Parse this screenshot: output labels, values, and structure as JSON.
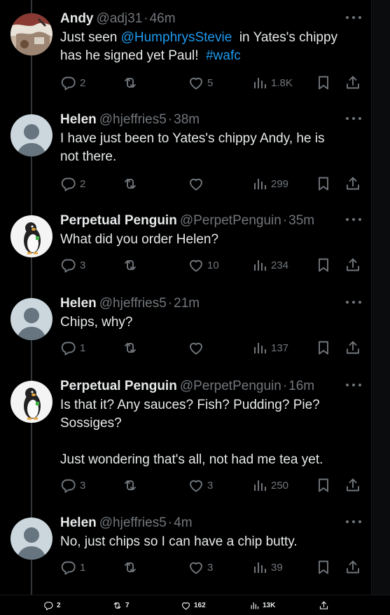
{
  "tweets": [
    {
      "name": "Andy",
      "handle": "@adj31",
      "time": "46m",
      "avatar": "photo-avatar",
      "lines": [
        {
          "parts": [
            {
              "t": "Just seen ",
              "link": false
            },
            {
              "t": "@HumphrysStevie",
              "link": true
            },
            {
              "t": "  in Yates's chippy",
              "link": false
            }
          ]
        },
        {
          "parts": [
            {
              "t": "has he signed yet Paul!  ",
              "link": false
            },
            {
              "t": "#wafc",
              "link": true
            }
          ]
        }
      ],
      "replies": "2",
      "retweets": "",
      "likes": "5",
      "views": "1.8K"
    },
    {
      "name": "Helen",
      "handle": "@hjeffries5",
      "time": "38m",
      "avatar": "default-avatar",
      "lines": [
        {
          "parts": [
            {
              "t": "I have just been to Yates's chippy Andy, he is",
              "link": false
            }
          ]
        },
        {
          "parts": [
            {
              "t": "not there.",
              "link": false
            }
          ]
        }
      ],
      "replies": "2",
      "retweets": "",
      "likes": "",
      "views": "299"
    },
    {
      "name": "Perpetual Penguin",
      "handle": "@PerpetPenguin",
      "time": "35m",
      "avatar": "penguin-avatar",
      "lines": [
        {
          "parts": [
            {
              "t": "What did you order Helen?",
              "link": false
            }
          ]
        }
      ],
      "replies": "3",
      "retweets": "",
      "likes": "10",
      "views": "234"
    },
    {
      "name": "Helen",
      "handle": "@hjeffries5",
      "time": "21m",
      "avatar": "default-avatar",
      "lines": [
        {
          "parts": [
            {
              "t": "Chips, why?",
              "link": false
            }
          ]
        }
      ],
      "replies": "1",
      "retweets": "",
      "likes": "",
      "views": "137"
    },
    {
      "name": "Perpetual Penguin",
      "handle": "@PerpetPenguin",
      "time": "16m",
      "avatar": "penguin-avatar",
      "lines": [
        {
          "parts": [
            {
              "t": "Is that it? Any sauces? Fish? Pudding? Pie?",
              "link": false
            }
          ]
        },
        {
          "parts": [
            {
              "t": "Sossiges?",
              "link": false
            }
          ]
        },
        {
          "parts": []
        },
        {
          "parts": [
            {
              "t": "Just wondering that's all, not had me tea yet.",
              "link": false
            }
          ]
        }
      ],
      "replies": "3",
      "retweets": "",
      "likes": "3",
      "views": "250"
    },
    {
      "name": "Helen",
      "handle": "@hjeffries5",
      "time": "4m",
      "avatar": "default-avatar",
      "lines": [
        {
          "parts": [
            {
              "t": "No, just chips so I can have a chip butty.",
              "link": false
            }
          ]
        }
      ],
      "replies": "1",
      "retweets": "",
      "likes": "3",
      "views": "39"
    }
  ],
  "footer": {
    "replies": "2",
    "retweets": "7",
    "likes": "162",
    "views": "13K"
  },
  "icons": {
    "reply": "reply-icon",
    "retweet": "retweet-icon",
    "like": "heart-icon",
    "views": "views-icon",
    "bookmark": "bookmark-icon",
    "share": "share-icon",
    "more": "more-icon"
  },
  "colors": {
    "background": "#000000",
    "text": "#e7e9ea",
    "muted": "#71767b",
    "link": "#1d9bf0",
    "thread": "#333639"
  }
}
